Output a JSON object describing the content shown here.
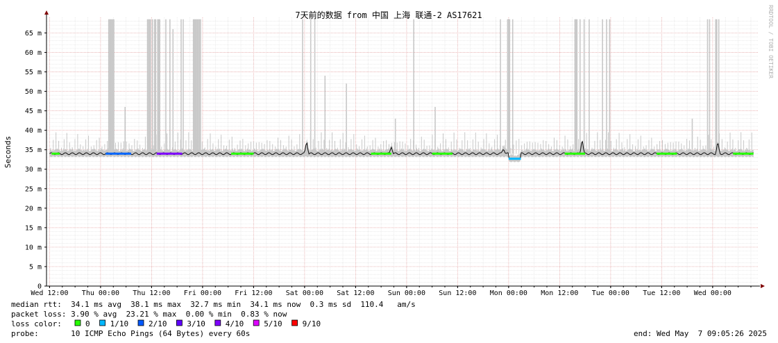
{
  "chart_data": {
    "type": "line",
    "title": "7天前的数据 from 中国 上海 联通-2 AS17621",
    "ylabel": "Seconds",
    "watermark": "RRDTOOL / TOBI OETIKER",
    "ylim": [
      0,
      0.069
    ],
    "yticks": [
      {
        "value": 0,
        "label": "0"
      },
      {
        "value": 0.005,
        "label": "5 m"
      },
      {
        "value": 0.01,
        "label": "10 m"
      },
      {
        "value": 0.015,
        "label": "15 m"
      },
      {
        "value": 0.02,
        "label": "20 m"
      },
      {
        "value": 0.025,
        "label": "25 m"
      },
      {
        "value": 0.03,
        "label": "30 m"
      },
      {
        "value": 0.035,
        "label": "35 m"
      },
      {
        "value": 0.04,
        "label": "40 m"
      },
      {
        "value": 0.045,
        "label": "45 m"
      },
      {
        "value": 0.05,
        "label": "50 m"
      },
      {
        "value": 0.055,
        "label": "55 m"
      },
      {
        "value": 0.06,
        "label": "60 m"
      },
      {
        "value": 0.065,
        "label": "65 m"
      }
    ],
    "xlim": [
      -0.03,
      6.95
    ],
    "xticks": [
      {
        "value": 0,
        "label": "Wed 12:00"
      },
      {
        "value": 0.5,
        "label": "Thu 00:00"
      },
      {
        "value": 1.0,
        "label": "Thu 12:00"
      },
      {
        "value": 1.5,
        "label": "Fri 00:00"
      },
      {
        "value": 2.0,
        "label": "Fri 12:00"
      },
      {
        "value": 2.5,
        "label": "Sat 00:00"
      },
      {
        "value": 3.0,
        "label": "Sat 12:00"
      },
      {
        "value": 3.5,
        "label": "Sun 00:00"
      },
      {
        "value": 4.0,
        "label": "Sun 12:00"
      },
      {
        "value": 4.5,
        "label": "Mon 00:00"
      },
      {
        "value": 5.0,
        "label": "Mon 12:00"
      },
      {
        "value": 5.5,
        "label": "Tue 00:00"
      },
      {
        "value": 6.0,
        "label": "Tue 12:00"
      },
      {
        "value": 6.5,
        "label": "Wed 00:00"
      }
    ],
    "baseline_ms": 34.0,
    "dip": {
      "x": [
        4.5,
        4.62
      ],
      "ms": 32.7
    },
    "spikes": [
      {
        "x": 0.58,
        "ms": 68.5
      },
      {
        "x": 0.59,
        "ms": 68.5
      },
      {
        "x": 0.6,
        "ms": 68.5
      },
      {
        "x": 0.61,
        "ms": 68.5
      },
      {
        "x": 0.62,
        "ms": 68.5
      },
      {
        "x": 0.63,
        "ms": 68.5
      },
      {
        "x": 0.74,
        "ms": 46.0
      },
      {
        "x": 0.96,
        "ms": 68.5
      },
      {
        "x": 0.97,
        "ms": 68.5
      },
      {
        "x": 0.98,
        "ms": 68.5
      },
      {
        "x": 0.99,
        "ms": 68.5
      },
      {
        "x": 1.01,
        "ms": 68.5
      },
      {
        "x": 1.03,
        "ms": 68.5
      },
      {
        "x": 1.04,
        "ms": 68.5
      },
      {
        "x": 1.06,
        "ms": 68.5
      },
      {
        "x": 1.07,
        "ms": 68.5
      },
      {
        "x": 1.08,
        "ms": 68.5
      },
      {
        "x": 1.14,
        "ms": 68.5
      },
      {
        "x": 1.18,
        "ms": 68.5
      },
      {
        "x": 1.21,
        "ms": 66.0
      },
      {
        "x": 1.29,
        "ms": 68.5
      },
      {
        "x": 1.31,
        "ms": 68.5
      },
      {
        "x": 1.41,
        "ms": 68.5
      },
      {
        "x": 1.42,
        "ms": 68.5
      },
      {
        "x": 1.43,
        "ms": 68.5
      },
      {
        "x": 1.44,
        "ms": 68.5
      },
      {
        "x": 1.45,
        "ms": 68.5
      },
      {
        "x": 1.46,
        "ms": 68.5
      },
      {
        "x": 1.47,
        "ms": 68.5
      },
      {
        "x": 1.48,
        "ms": 68.5
      },
      {
        "x": 2.48,
        "ms": 68.5
      },
      {
        "x": 2.56,
        "ms": 68.5
      },
      {
        "x": 2.6,
        "ms": 68.5
      },
      {
        "x": 2.7,
        "ms": 54.0
      },
      {
        "x": 2.91,
        "ms": 52.0
      },
      {
        "x": 3.39,
        "ms": 43.0
      },
      {
        "x": 3.57,
        "ms": 68.5
      },
      {
        "x": 3.78,
        "ms": 46.0
      },
      {
        "x": 4.42,
        "ms": 68.5
      },
      {
        "x": 4.49,
        "ms": 68.5
      },
      {
        "x": 4.5,
        "ms": 68.5
      },
      {
        "x": 4.51,
        "ms": 68.5
      },
      {
        "x": 4.54,
        "ms": 68.5
      },
      {
        "x": 5.15,
        "ms": 68.5
      },
      {
        "x": 5.16,
        "ms": 68.5
      },
      {
        "x": 5.17,
        "ms": 68.5
      },
      {
        "x": 5.2,
        "ms": 68.5
      },
      {
        "x": 5.24,
        "ms": 68.5
      },
      {
        "x": 5.29,
        "ms": 68.5
      },
      {
        "x": 5.42,
        "ms": 68.5
      },
      {
        "x": 5.46,
        "ms": 68.5
      },
      {
        "x": 5.49,
        "ms": 68.5
      },
      {
        "x": 6.3,
        "ms": 43.0
      },
      {
        "x": 6.45,
        "ms": 68.5
      },
      {
        "x": 6.47,
        "ms": 68.5
      },
      {
        "x": 6.53,
        "ms": 68.5
      },
      {
        "x": 6.54,
        "ms": 68.5
      },
      {
        "x": 6.56,
        "ms": 68.5
      }
    ],
    "median_bumps": [
      {
        "x": 2.52,
        "ms": 37.5
      },
      {
        "x": 3.35,
        "ms": 36.0
      },
      {
        "x": 4.45,
        "ms": 35.5
      },
      {
        "x": 5.22,
        "ms": 38.1
      },
      {
        "x": 6.55,
        "ms": 37.0
      }
    ],
    "loss_segments": [
      {
        "x": [
          0.02,
          0.1
        ],
        "color": "#26ff00"
      },
      {
        "x": [
          0.55,
          0.8
        ],
        "color": "#0066ff"
      },
      {
        "x": [
          1.05,
          1.3
        ],
        "color": "#7e00ff"
      },
      {
        "x": [
          1.78,
          2.0
        ],
        "color": "#26ff00"
      },
      {
        "x": [
          3.15,
          3.35
        ],
        "color": "#26ff00"
      },
      {
        "x": [
          3.75,
          3.95
        ],
        "color": "#26ff00"
      },
      {
        "x": [
          5.05,
          5.25
        ],
        "color": "#26ff00"
      },
      {
        "x": [
          5.95,
          6.15
        ],
        "color": "#26ff00"
      },
      {
        "x": [
          6.7,
          6.9
        ],
        "color": "#26ff00"
      }
    ]
  },
  "stats": {
    "median_rtt": "median rtt:  34.1 ms avg  38.1 ms max  32.7 ms min  34.1 ms now  0.3 ms sd  110.4   am/s",
    "packet_loss": "packet loss: 3.90 % avg  23.21 % max  0.00 % min  0.83 % now",
    "loss_color_label": "loss color:",
    "probe": "probe:       10 ICMP Echo Pings (64 Bytes) every 60s",
    "end": "end: Wed May  7 09:05:26 2025"
  },
  "loss_legend": [
    {
      "label": "0",
      "color": "#26ff00"
    },
    {
      "label": "1/10",
      "color": "#00b8ff"
    },
    {
      "label": "2/10",
      "color": "#0059ff"
    },
    {
      "label": "3/10",
      "color": "#5e00ff"
    },
    {
      "label": "4/10",
      "color": "#7e00ff"
    },
    {
      "label": "5/10",
      "color": "#dd00ff"
    },
    {
      "label": "9/10",
      "color": "#ff0000"
    }
  ],
  "colors": {
    "minor_grid": "#dddddd",
    "major_grid": "#e8a0a0",
    "smoke": "#c8c8c8",
    "median": "#111111",
    "axis_arrow": "#800000",
    "watermark": "#b0b0b0"
  }
}
